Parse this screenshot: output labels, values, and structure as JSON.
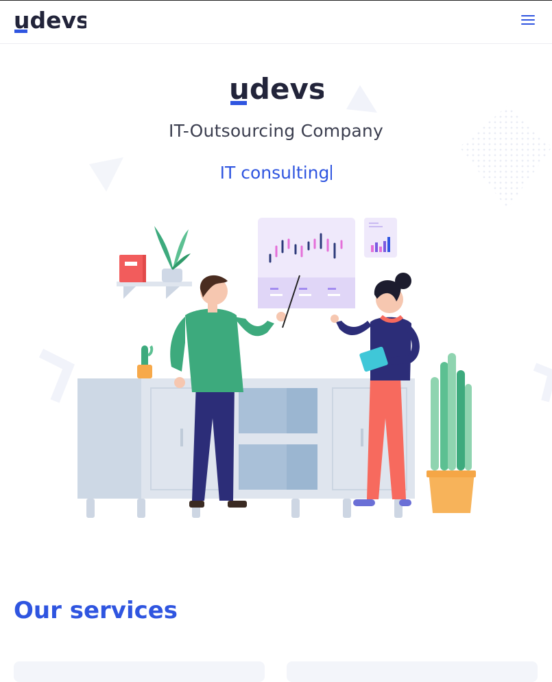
{
  "brand": {
    "logo_text": "udevs",
    "accent": "#2f55e0",
    "dark": "#22243a"
  },
  "header": {
    "menu_icon": "hamburger-menu-icon"
  },
  "hero": {
    "tagline": "IT-Outsourcing Company",
    "typed_text": "IT consulting",
    "illustration": "team-presenting-chart-illustration"
  },
  "services": {
    "title": "Our services"
  }
}
